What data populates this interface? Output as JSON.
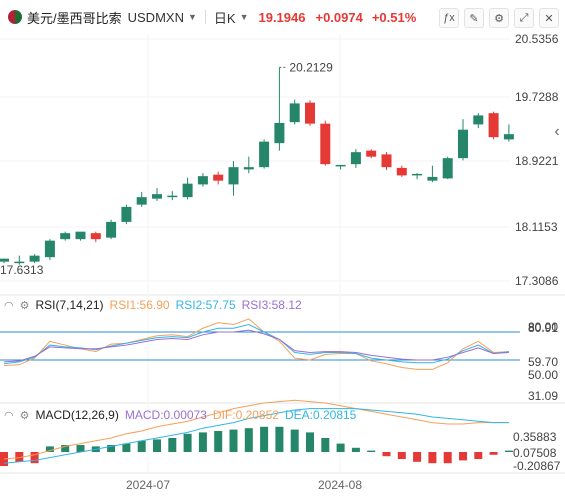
{
  "header": {
    "name": "美元/墨西哥比索",
    "code": "USDMXN",
    "interval": "日K",
    "last": "19.1946",
    "change": "+0.0974",
    "change_pct": "+0.51%",
    "up_color": "#26866a",
    "down_color": "#e53935",
    "tools": [
      "indicator-icon",
      "draw-icon",
      "settings-icon",
      "fullscreen-icon",
      "close-icon"
    ]
  },
  "price_axis": [
    "20.5356",
    "19.7288",
    "18.9221",
    "18.1153",
    "17.3086"
  ],
  "annotations": {
    "high": "20.2129",
    "low": "17.6313"
  },
  "rsi": {
    "title": "RSI(7,14,21)",
    "rsi1": "RSI1:56.90",
    "rsi2": "RSI2:57.75",
    "rsi3": "RSI3:58.12",
    "axis": [
      "80.00",
      "80.91",
      "59.70",
      "50.00",
      "31.09"
    ],
    "colors": [
      "#f5a05a",
      "#33b5e5",
      "#9b6fd1"
    ]
  },
  "macd": {
    "title": "MACD(12,26,9)",
    "macd": "MACD:0.00073",
    "dif": "DIF:0.20852",
    "dea": "DEA:0.20815",
    "axis": [
      "0.35883",
      "0.07508",
      "-0.20867"
    ],
    "colors": [
      "#9b6fd1",
      "#f5a05a",
      "#33b5e5"
    ]
  },
  "time_axis": [
    "2024-07",
    "2024-08"
  ],
  "chart_data": {
    "type": "candlestick",
    "ylim": [
      17.3086,
      20.5356
    ],
    "candles": [
      {
        "o": 17.62,
        "h": 17.66,
        "l": 17.6,
        "c": 17.66
      },
      {
        "o": 17.6,
        "h": 17.7,
        "l": 17.58,
        "c": 17.62
      },
      {
        "o": 17.62,
        "h": 17.72,
        "l": 17.6,
        "c": 17.7
      },
      {
        "o": 17.68,
        "h": 17.92,
        "l": 17.64,
        "c": 17.9
      },
      {
        "o": 17.92,
        "h": 18.02,
        "l": 17.9,
        "c": 18.0
      },
      {
        "o": 17.92,
        "h": 18.01,
        "l": 17.9,
        "c": 18.02
      },
      {
        "o": 18.0,
        "h": 18.02,
        "l": 17.88,
        "c": 17.92
      },
      {
        "o": 17.94,
        "h": 18.18,
        "l": 17.92,
        "c": 18.15
      },
      {
        "o": 18.15,
        "h": 18.38,
        "l": 18.12,
        "c": 18.35
      },
      {
        "o": 18.38,
        "h": 18.55,
        "l": 18.35,
        "c": 18.48
      },
      {
        "o": 18.46,
        "h": 18.6,
        "l": 18.43,
        "c": 18.52
      },
      {
        "o": 18.48,
        "h": 18.56,
        "l": 18.44,
        "c": 18.5
      },
      {
        "o": 18.48,
        "h": 18.74,
        "l": 18.45,
        "c": 18.66
      },
      {
        "o": 18.65,
        "h": 18.8,
        "l": 18.62,
        "c": 18.76
      },
      {
        "o": 18.78,
        "h": 18.82,
        "l": 18.65,
        "c": 18.7
      },
      {
        "o": 18.65,
        "h": 18.96,
        "l": 18.5,
        "c": 18.88
      },
      {
        "o": 18.85,
        "h": 19.02,
        "l": 18.8,
        "c": 18.88
      },
      {
        "o": 18.88,
        "h": 19.25,
        "l": 18.86,
        "c": 19.22
      },
      {
        "o": 19.2,
        "h": 20.21,
        "l": 19.1,
        "c": 19.47
      },
      {
        "o": 19.48,
        "h": 19.78,
        "l": 19.45,
        "c": 19.73
      },
      {
        "o": 19.74,
        "h": 19.77,
        "l": 19.43,
        "c": 19.46
      },
      {
        "o": 19.46,
        "h": 19.5,
        "l": 18.9,
        "c": 18.92
      },
      {
        "o": 18.9,
        "h": 18.91,
        "l": 18.85,
        "c": 18.91
      },
      {
        "o": 18.92,
        "h": 19.12,
        "l": 18.87,
        "c": 19.08
      },
      {
        "o": 19.1,
        "h": 19.12,
        "l": 19.0,
        "c": 19.02
      },
      {
        "o": 19.05,
        "h": 19.08,
        "l": 18.84,
        "c": 18.88
      },
      {
        "o": 18.87,
        "h": 18.9,
        "l": 18.75,
        "c": 18.77
      },
      {
        "o": 18.77,
        "h": 18.8,
        "l": 18.72,
        "c": 18.79
      },
      {
        "o": 18.7,
        "h": 18.9,
        "l": 18.68,
        "c": 18.75
      },
      {
        "o": 18.73,
        "h": 19.02,
        "l": 18.72,
        "c": 19.0
      },
      {
        "o": 19.0,
        "h": 19.52,
        "l": 18.97,
        "c": 19.38
      },
      {
        "o": 19.45,
        "h": 19.6,
        "l": 19.4,
        "c": 19.57
      },
      {
        "o": 19.6,
        "h": 19.62,
        "l": 19.25,
        "c": 19.28
      },
      {
        "o": 19.25,
        "h": 19.45,
        "l": 19.22,
        "c": 19.32
      }
    ],
    "rsi_series": {
      "rsi1": [
        44,
        45,
        52,
        70,
        66,
        62,
        59,
        67,
        68,
        72,
        76,
        77,
        75,
        84,
        90,
        88,
        94,
        80,
        70,
        52,
        50,
        56,
        57,
        57,
        49,
        46,
        42,
        40,
        40,
        47,
        62,
        70,
        58,
        59
      ],
      "rsi2": [
        46,
        48,
        53,
        66,
        64,
        63,
        61,
        65,
        68,
        71,
        74,
        75,
        74,
        80,
        84,
        84,
        88,
        80,
        72,
        58,
        56,
        58,
        58,
        57,
        52,
        50,
        48,
        47,
        47,
        51,
        60,
        66,
        57,
        59
      ],
      "rsi3": [
        48,
        49,
        54,
        64,
        63,
        62,
        62,
        64,
        66,
        69,
        72,
        73,
        72,
        77,
        80,
        80,
        82,
        78,
        72,
        60,
        58,
        59,
        59,
        58,
        55,
        53,
        51,
        50,
        50,
        53,
        58,
        63,
        57,
        58
      ]
    },
    "macd_series": {
      "dif": [
        -0.05,
        -0.04,
        -0.02,
        0.01,
        0.04,
        0.06,
        0.08,
        0.1,
        0.13,
        0.15,
        0.18,
        0.2,
        0.22,
        0.25,
        0.28,
        0.31,
        0.33,
        0.35,
        0.36,
        0.37,
        0.36,
        0.35,
        0.33,
        0.31,
        0.29,
        0.27,
        0.25,
        0.23,
        0.21,
        0.2,
        0.2,
        0.21,
        0.21,
        0.21
      ],
      "dea": [
        -0.08,
        -0.07,
        -0.06,
        -0.04,
        -0.02,
        0.0,
        0.02,
        0.04,
        0.06,
        0.08,
        0.1,
        0.12,
        0.14,
        0.17,
        0.19,
        0.21,
        0.24,
        0.26,
        0.28,
        0.3,
        0.31,
        0.31,
        0.31,
        0.31,
        0.3,
        0.29,
        0.28,
        0.27,
        0.25,
        0.24,
        0.23,
        0.22,
        0.21,
        0.21
      ],
      "hist": [
        -0.1,
        -0.07,
        -0.08,
        0.04,
        0.05,
        0.05,
        0.04,
        0.05,
        0.06,
        0.08,
        0.09,
        0.1,
        0.13,
        0.14,
        0.15,
        0.16,
        0.17,
        0.18,
        0.18,
        0.16,
        0.14,
        0.1,
        0.06,
        0.03,
        0.01,
        -0.03,
        -0.05,
        -0.07,
        -0.08,
        -0.08,
        -0.06,
        -0.05,
        -0.02,
        0.01
      ]
    }
  }
}
